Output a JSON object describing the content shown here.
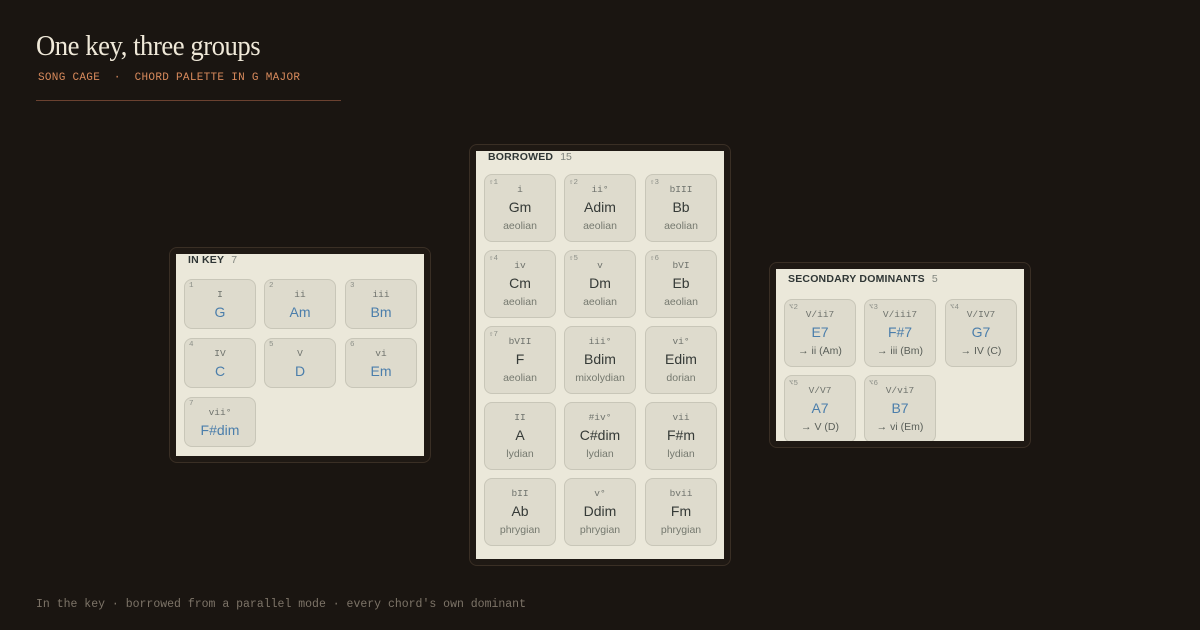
{
  "header": {
    "title": "One key, three groups",
    "subtitle": "SONG CAGE  ·  CHORD PALETTE IN G MAJOR"
  },
  "footer": "In the key · borrowed from a parallel mode · every chord's own dominant",
  "groups": {
    "in_key": {
      "name": "IN KEY",
      "count": "7",
      "chords": [
        {
          "num": "1",
          "roman": "I",
          "chord": "G"
        },
        {
          "num": "2",
          "roman": "ii",
          "chord": "Am"
        },
        {
          "num": "3",
          "roman": "iii",
          "chord": "Bm"
        },
        {
          "num": "4",
          "roman": "IV",
          "chord": "C"
        },
        {
          "num": "5",
          "roman": "V",
          "chord": "D"
        },
        {
          "num": "6",
          "roman": "vi",
          "chord": "Em"
        },
        {
          "num": "7",
          "roman": "vii°",
          "chord": "F#dim"
        }
      ]
    },
    "borrowed": {
      "name": "BORROWED",
      "count": "15",
      "chords": [
        {
          "num": "⇧1",
          "roman": "i",
          "chord": "Gm",
          "mode": "aeolian"
        },
        {
          "num": "⇧2",
          "roman": "ii°",
          "chord": "Adim",
          "mode": "aeolian"
        },
        {
          "num": "⇧3",
          "roman": "bIII",
          "chord": "Bb",
          "mode": "aeolian"
        },
        {
          "num": "⇧4",
          "roman": "iv",
          "chord": "Cm",
          "mode": "aeolian"
        },
        {
          "num": "⇧5",
          "roman": "v",
          "chord": "Dm",
          "mode": "aeolian"
        },
        {
          "num": "⇧6",
          "roman": "bVI",
          "chord": "Eb",
          "mode": "aeolian"
        },
        {
          "num": "⇧7",
          "roman": "bVII",
          "chord": "F",
          "mode": "aeolian"
        },
        {
          "num": "",
          "roman": "iii°",
          "chord": "Bdim",
          "mode": "mixolydian"
        },
        {
          "num": "",
          "roman": "vi°",
          "chord": "Edim",
          "mode": "dorian"
        },
        {
          "num": "",
          "roman": "II",
          "chord": "A",
          "mode": "lydian"
        },
        {
          "num": "",
          "roman": "#iv°",
          "chord": "C#dim",
          "mode": "lydian"
        },
        {
          "num": "",
          "roman": "vii",
          "chord": "F#m",
          "mode": "lydian"
        },
        {
          "num": "",
          "roman": "bII",
          "chord": "Ab",
          "mode": "phrygian"
        },
        {
          "num": "",
          "roman": "v°",
          "chord": "Ddim",
          "mode": "phrygian"
        },
        {
          "num": "",
          "roman": "bvii",
          "chord": "Fm",
          "mode": "phrygian"
        }
      ]
    },
    "secondary": {
      "name": "SECONDARY DOMINANTS",
      "count": "5",
      "chords": [
        {
          "num": "⌥2",
          "roman": "V/ii7",
          "chord": "E7",
          "target": "→ ii (Am)"
        },
        {
          "num": "⌥3",
          "roman": "V/iii7",
          "chord": "F#7",
          "target": "→ iii (Bm)"
        },
        {
          "num": "⌥4",
          "roman": "V/IV7",
          "chord": "G7",
          "target": "→ IV (C)"
        },
        {
          "num": "⌥5",
          "roman": "V/V7",
          "chord": "A7",
          "target": "→ V (D)"
        },
        {
          "num": "⌥6",
          "roman": "V/vi7",
          "chord": "B7",
          "target": "→ vi (Em)"
        }
      ]
    }
  }
}
